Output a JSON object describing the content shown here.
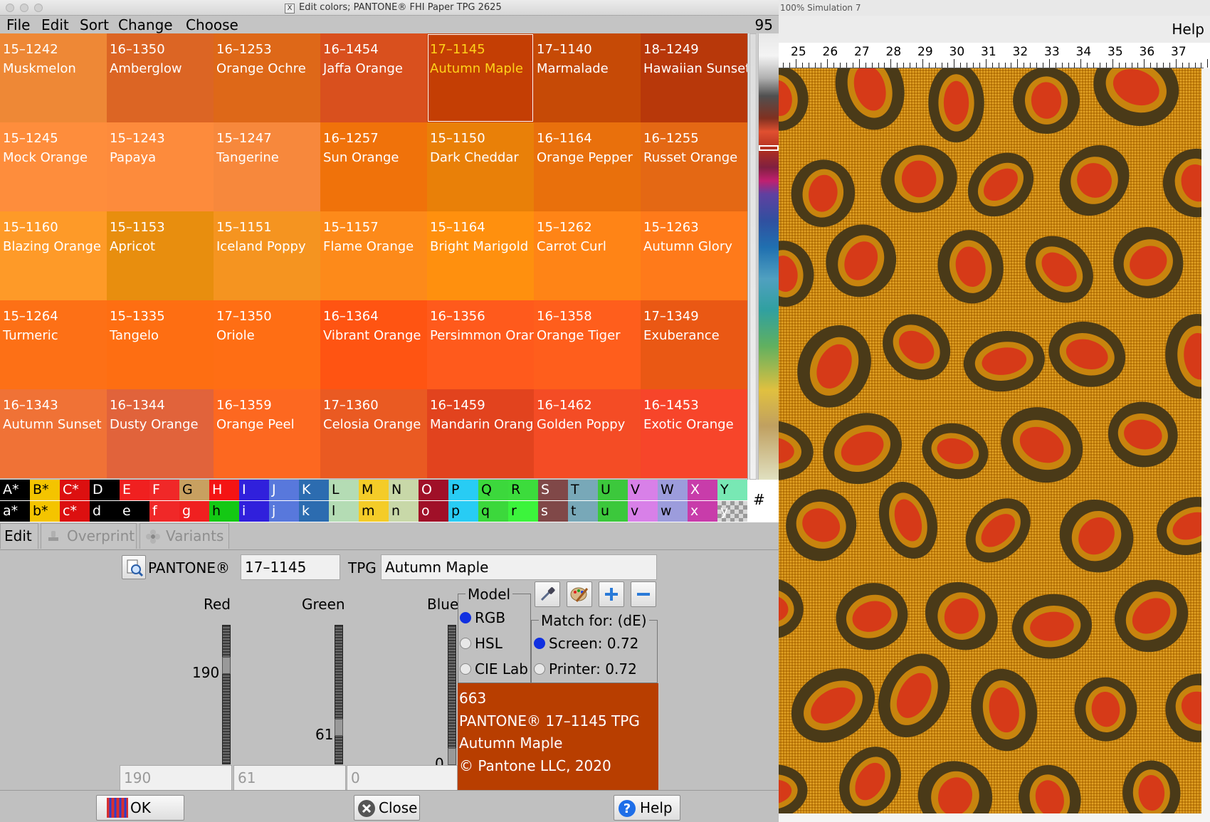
{
  "window": {
    "title": "Edit colors; PANTONE® FHI Paper TPG 2625",
    "title_icon": "X"
  },
  "menu": {
    "items": [
      "File",
      "Edit",
      "Sort",
      "Change",
      "Choose"
    ],
    "count": "95"
  },
  "swatches": [
    {
      "code": "15–1242",
      "name": "Muskmelon",
      "color": "#ee8836"
    },
    {
      "code": "16–1350",
      "name": "Amberglow",
      "color": "#dc6524"
    },
    {
      "code": "16–1253",
      "name": "Orange Ochre",
      "color": "#de6818"
    },
    {
      "code": "16–1454",
      "name": "Jaffa Orange",
      "color": "#d9501e"
    },
    {
      "code": "17–1145",
      "name": "Autumn Maple",
      "color": "#c43e04"
    },
    {
      "code": "17–1140",
      "name": "Marmalade",
      "color": "#c64a06"
    },
    {
      "code": "18–1249",
      "name": "Hawaiian Sunset",
      "color": "#b8380a"
    },
    {
      "code": "15–1245",
      "name": "Mock Orange",
      "color": "#fe8d3c"
    },
    {
      "code": "15–1243",
      "name": "Papaya",
      "color": "#fd8b3c"
    },
    {
      "code": "15–1247",
      "name": "Tangerine",
      "color": "#f7883c"
    },
    {
      "code": "16–1257",
      "name": "Sun Orange",
      "color": "#f0720a"
    },
    {
      "code": "15–1150",
      "name": "Dark Cheddar",
      "color": "#e98008"
    },
    {
      "code": "16–1164",
      "name": "Orange Pepper",
      "color": "#e9700c"
    },
    {
      "code": "16–1255",
      "name": "Russet Orange",
      "color": "#e46814"
    },
    {
      "code": "15–1160",
      "name": "Blazing Orange",
      "color": "#fe9a28"
    },
    {
      "code": "15–1153",
      "name": "Apricot",
      "color": "#e88e0e"
    },
    {
      "code": "15–1151",
      "name": "Iceland Poppy",
      "color": "#f59420"
    },
    {
      "code": "15–1157",
      "name": "Flame Orange",
      "color": "#fd8a1a"
    },
    {
      "code": "15–1164",
      "name": "Bright Marigold",
      "color": "#ff900e"
    },
    {
      "code": "15–1262",
      "name": "Carrot Curl",
      "color": "#ff8416"
    },
    {
      "code": "15–1263",
      "name": "Autumn Glory",
      "color": "#ff7a1a"
    },
    {
      "code": "15–1264",
      "name": "Turmeric",
      "color": "#fd7016"
    },
    {
      "code": "15–1335",
      "name": "Tangelo",
      "color": "#fe6e12"
    },
    {
      "code": "17–1350",
      "name": "Oriole",
      "color": "#ff6e14"
    },
    {
      "code": "16–1364",
      "name": "Vibrant Orange",
      "color": "#ff5412"
    },
    {
      "code": "16–1356",
      "name": "Persimmon Orange",
      "color": "#ff5a1c"
    },
    {
      "code": "16–1358",
      "name": "Orange Tiger",
      "color": "#ff5e1c"
    },
    {
      "code": "17–1349",
      "name": "Exuberance",
      "color": "#ea5814"
    },
    {
      "code": "16–1343",
      "name": "Autumn Sunset",
      "color": "#f07236"
    },
    {
      "code": "16–1344",
      "name": "Dusty Orange",
      "color": "#e1633b"
    },
    {
      "code": "16–1359",
      "name": "Orange Peel",
      "color": "#fd6820"
    },
    {
      "code": "17–1360",
      "name": "Celosia Orange",
      "color": "#ea5a22"
    },
    {
      "code": "16–1459",
      "name": "Mandarin Orange",
      "color": "#e2431e"
    },
    {
      "code": "16–1462",
      "name": "Golden Poppy",
      "color": "#f44c25"
    },
    {
      "code": "16–1453",
      "name": "Exotic Orange",
      "color": "#f7452a"
    }
  ],
  "selected_swatch": "17–1145",
  "palette": {
    "upper": [
      {
        "k": "A*",
        "bg": "#000000",
        "fg": "#ffffff"
      },
      {
        "k": "B*",
        "bg": "#f4c400",
        "fg": "#000000"
      },
      {
        "k": "C*",
        "bg": "#dc1010",
        "fg": "#ffffff"
      },
      {
        "k": "D",
        "bg": "#000000",
        "fg": "#ffffff"
      },
      {
        "k": "E",
        "bg": "#f02020",
        "fg": "#ffffff"
      },
      {
        "k": "F",
        "bg": "#f02828",
        "fg": "#ffffff"
      },
      {
        "k": "G",
        "bg": "#c8a060",
        "fg": "#000000"
      },
      {
        "k": "H",
        "bg": "#f41414",
        "fg": "#ffffff"
      },
      {
        "k": "I",
        "bg": "#3020dc",
        "fg": "#ffffff"
      },
      {
        "k": "J",
        "bg": "#5878dc",
        "fg": "#ffffff"
      },
      {
        "k": "K",
        "bg": "#2c6cb0",
        "fg": "#ffffff"
      },
      {
        "k": "L",
        "bg": "#b4dcb4",
        "fg": "#000000"
      },
      {
        "k": "M",
        "bg": "#f4cc28",
        "fg": "#000000"
      },
      {
        "k": "N",
        "bg": "#c8d8a8",
        "fg": "#000000"
      },
      {
        "k": "O",
        "bg": "#a01028",
        "fg": "#ffffff"
      },
      {
        "k": "P",
        "bg": "#28ccf4",
        "fg": "#000000"
      },
      {
        "k": "Q",
        "bg": "#3cd83c",
        "fg": "#000000"
      },
      {
        "k": "R",
        "bg": "#3cdc3c",
        "fg": "#000000"
      },
      {
        "k": "S",
        "bg": "#804848",
        "fg": "#ffffff"
      },
      {
        "k": "T",
        "bg": "#78a8b8",
        "fg": "#000000"
      },
      {
        "k": "U",
        "bg": "#3cc83c",
        "fg": "#000000"
      },
      {
        "k": "V",
        "bg": "#d880e8",
        "fg": "#000000"
      },
      {
        "k": "W",
        "bg": "#9c9cdc",
        "fg": "#000000"
      },
      {
        "k": "X",
        "bg": "#c83caa",
        "fg": "#ffffff"
      },
      {
        "k": "Y",
        "bg": "#78e8b4",
        "fg": "#000000"
      }
    ],
    "lower": [
      {
        "k": "a*",
        "bg": "#000000",
        "fg": "#ffffff"
      },
      {
        "k": "b*",
        "bg": "#f4c400",
        "fg": "#000000"
      },
      {
        "k": "c*",
        "bg": "#dc1010",
        "fg": "#ffffff"
      },
      {
        "k": "d",
        "bg": "#000000",
        "fg": "#ffffff"
      },
      {
        "k": "e",
        "bg": "#000000",
        "fg": "#ffffff"
      },
      {
        "k": "f",
        "bg": "#f02828",
        "fg": "#ffffff"
      },
      {
        "k": "g",
        "bg": "#f02020",
        "fg": "#ffffff"
      },
      {
        "k": "h",
        "bg": "#14c814",
        "fg": "#000000"
      },
      {
        "k": "i",
        "bg": "#3020dc",
        "fg": "#ffffff"
      },
      {
        "k": "j",
        "bg": "#5878dc",
        "fg": "#ffffff"
      },
      {
        "k": "k",
        "bg": "#2c6cb0",
        "fg": "#ffffff"
      },
      {
        "k": "l",
        "bg": "#b4dcb4",
        "fg": "#000000"
      },
      {
        "k": "m",
        "bg": "#f4cc28",
        "fg": "#000000"
      },
      {
        "k": "n",
        "bg": "#c8d8a8",
        "fg": "#000000"
      },
      {
        "k": "o",
        "bg": "#a01028",
        "fg": "#ffffff"
      },
      {
        "k": "p",
        "bg": "#28ccf4",
        "fg": "#000000"
      },
      {
        "k": "q",
        "bg": "#3cd83c",
        "fg": "#000000"
      },
      {
        "k": "r",
        "bg": "#3cf43c",
        "fg": "#000000"
      },
      {
        "k": "s",
        "bg": "#804848",
        "fg": "#ffffff"
      },
      {
        "k": "t",
        "bg": "#78a8b8",
        "fg": "#000000"
      },
      {
        "k": "u",
        "bg": "#3cc83c",
        "fg": "#000000"
      },
      {
        "k": "v",
        "bg": "#d880e8",
        "fg": "#000000"
      },
      {
        "k": "w",
        "bg": "#9c9cdc",
        "fg": "#000000"
      },
      {
        "k": "x",
        "bg": "#c83caa",
        "fg": "#ffffff"
      },
      {
        "k": "y",
        "bg": "checker",
        "fg": "#ffffff"
      }
    ],
    "hash": "#"
  },
  "tabs": {
    "edit": "Edit",
    "overprint": "Overprint",
    "variants": "Variants"
  },
  "editor": {
    "pantone_label": "PANTONE®",
    "pantone_code": "17–1145",
    "tpg_label": "TPG",
    "tpg_name": "Autumn Maple",
    "channels": [
      {
        "label": "Red",
        "value": "190",
        "fraction": 0.745
      },
      {
        "label": "Green",
        "value": "61",
        "fraction": 0.239
      },
      {
        "label": "Blue",
        "value": "0",
        "fraction": 0.0
      }
    ],
    "model": {
      "legend": "Model",
      "options": [
        "RGB",
        "HSL",
        "CIE Lab"
      ],
      "selected": "RGB"
    },
    "match": {
      "legend": "Match for: (dE)",
      "screen": "Screen: 0.72",
      "printer": "Printer: 0.72",
      "selected": "Screen"
    },
    "info": {
      "l1": "663",
      "l2": "PANTONE® 17–1145 TPG",
      "l3": "Autumn Maple",
      "l4": "© Pantone LLC, 2020",
      "color": "#b83e00"
    }
  },
  "buttons": {
    "ok": "OK",
    "close": "Close",
    "help": "Help"
  },
  "simulation": {
    "title": "100% Simulation 7",
    "help": "Help",
    "ruler": [
      "25",
      "26",
      "27",
      "28",
      "29",
      "30",
      "31",
      "32",
      "33",
      "34",
      "35",
      "36",
      "37"
    ]
  }
}
